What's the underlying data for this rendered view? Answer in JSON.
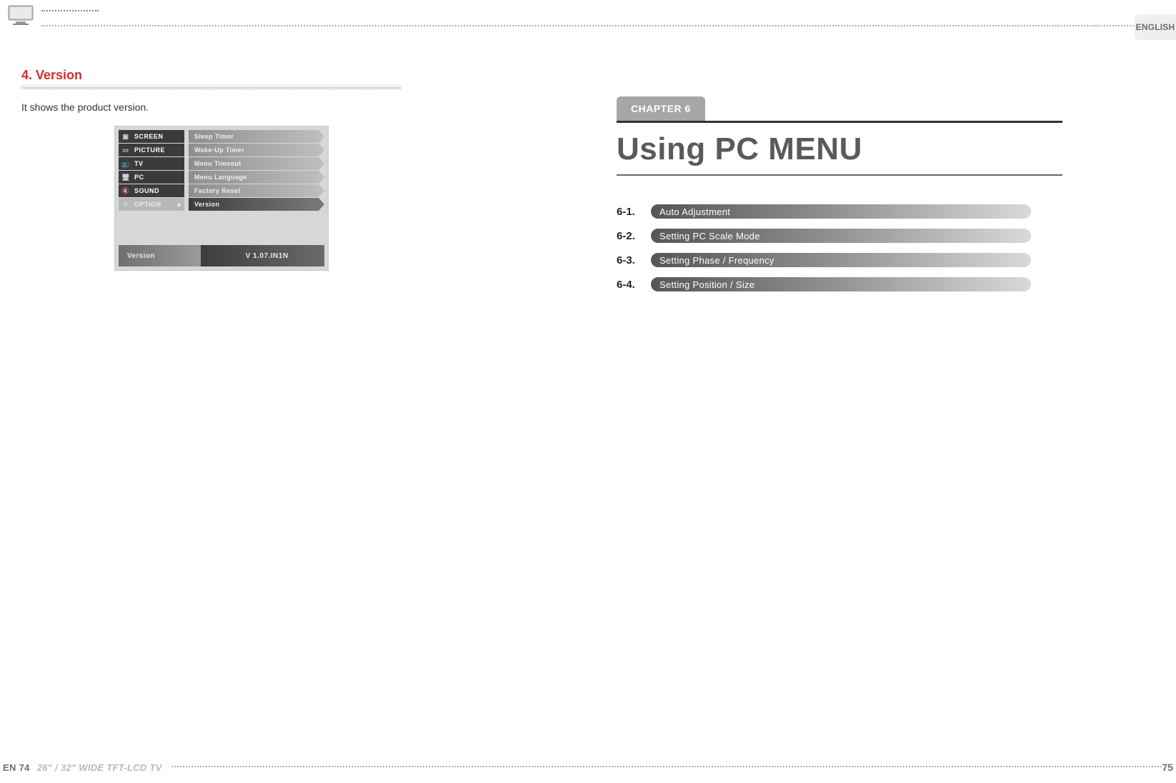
{
  "lang_tab": "ENGLISH",
  "left": {
    "section_number_title": "4. Version",
    "section_desc": "It shows the product version.",
    "osd": {
      "tabs": [
        {
          "label": "SCREEN",
          "icon": "▣"
        },
        {
          "label": "PICTURE",
          "icon": "▭"
        },
        {
          "label": "TV",
          "icon": "📺"
        },
        {
          "label": "PC",
          "icon": "🖥"
        },
        {
          "label": "SOUND",
          "icon": "🔇"
        },
        {
          "label": "OPTION",
          "icon": "⚙",
          "selected": true
        }
      ],
      "items": [
        {
          "label": "Sleep Timer"
        },
        {
          "label": "Wake-Up Timer"
        },
        {
          "label": "Menu Timeout"
        },
        {
          "label": "Menu Language"
        },
        {
          "label": "Factory Reset"
        },
        {
          "label": "Version",
          "selected": true
        }
      ],
      "status": {
        "label": "Version",
        "value": "V 1.07.IN1N"
      }
    }
  },
  "right": {
    "chapter_label": "CHAPTER 6",
    "chapter_title": "Using PC MENU",
    "toc": [
      {
        "num": "6-1.",
        "label": "Auto Adjustment"
      },
      {
        "num": "6-2.",
        "label": "Setting PC Scale Mode"
      },
      {
        "num": "6-3.",
        "label": "Setting Phase / Frequency"
      },
      {
        "num": "6-4.",
        "label": "Setting Position / Size"
      }
    ]
  },
  "footer": {
    "left_page_num": "EN 74",
    "left_model": "26\" / 32\" WIDE TFT-LCD TV",
    "right_page_num": "75"
  }
}
